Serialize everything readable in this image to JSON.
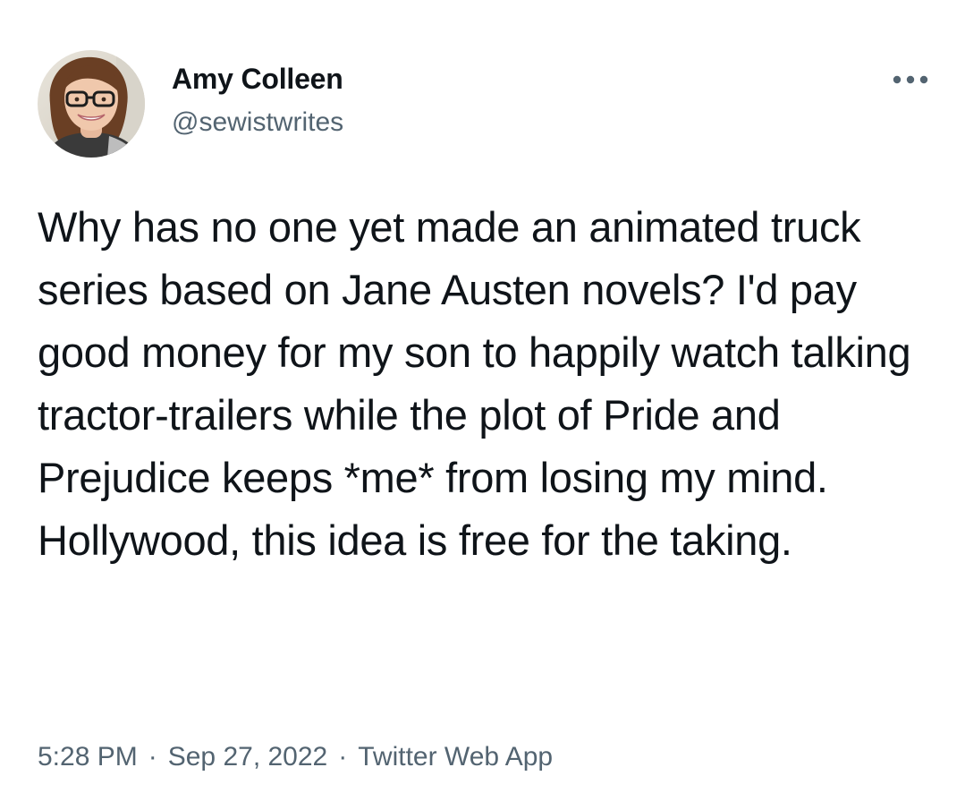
{
  "author": {
    "display_name": "Amy Colleen",
    "handle": "@sewistwrites",
    "avatar_icon": "profile-photo"
  },
  "menu": {
    "icon": "more-dots-icon"
  },
  "tweet": {
    "text": "Why has no one yet made an animated truck series based on Jane Austen novels? I'd pay good money for my son to happily watch talking tractor-trailers while the plot of Pride and Prejudice keeps *me* from losing my mind. Hollywood, this idea is free for the taking."
  },
  "meta": {
    "time": "5:28 PM",
    "separator": "·",
    "date": "Sep 27, 2022",
    "source": "Twitter Web App"
  },
  "colors": {
    "text_primary": "#0f1419",
    "text_secondary": "#536471",
    "background": "#ffffff"
  }
}
